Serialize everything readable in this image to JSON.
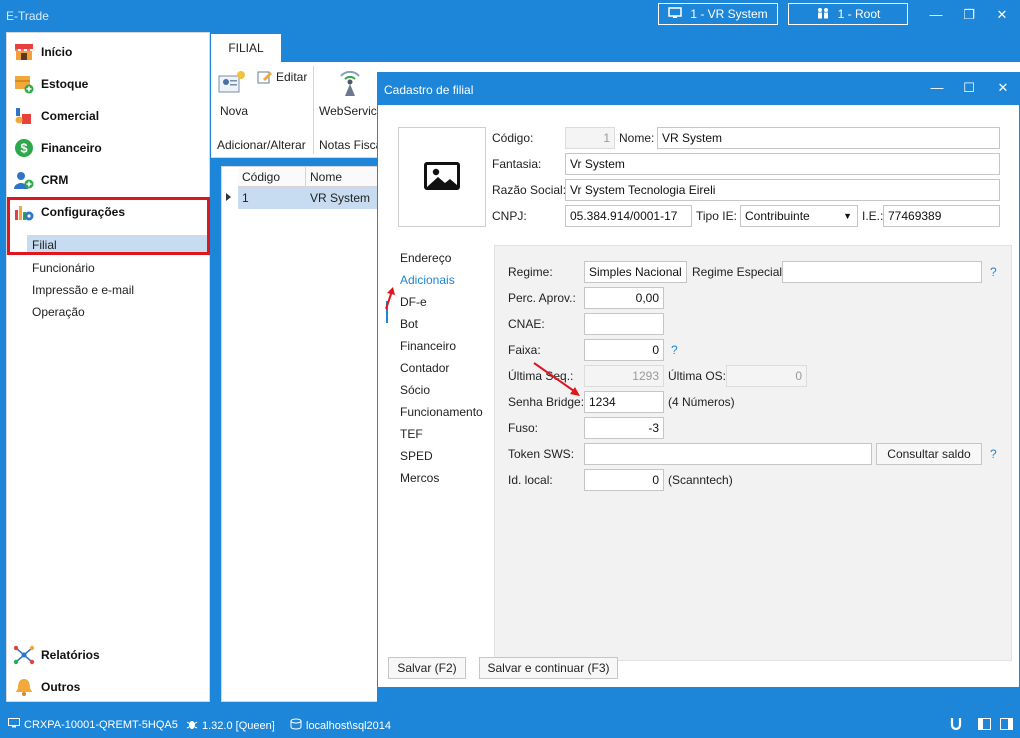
{
  "app": {
    "title": "E-Trade"
  },
  "top_bar": {
    "system_badge": "1 - VR System",
    "user_badge": "1 - Root"
  },
  "sidebar": {
    "items": [
      {
        "label": "Início"
      },
      {
        "label": "Estoque"
      },
      {
        "label": "Comercial"
      },
      {
        "label": "Financeiro"
      },
      {
        "label": "CRM"
      },
      {
        "label": "Configurações"
      }
    ],
    "sub_items": [
      {
        "label": "Filial"
      },
      {
        "label": "Funcionário"
      },
      {
        "label": "Impressão e e-mail"
      },
      {
        "label": "Operação"
      }
    ],
    "bottom_items": [
      {
        "label": "Relatórios"
      },
      {
        "label": "Outros"
      }
    ]
  },
  "background_page": {
    "tab": "FILIAL",
    "ribbon": {
      "nova": "Nova",
      "editar": "Editar",
      "webservice": "WebService",
      "group_add": "Adicionar/Alterar",
      "group_notas": "Notas Fisca"
    },
    "grid": {
      "headers": [
        "Código",
        "Nome"
      ],
      "rows": [
        {
          "codigo": "1",
          "nome": "VR System"
        }
      ]
    }
  },
  "dialog": {
    "title": "Cadastro de filial",
    "header": {
      "codigo_label": "Código:",
      "codigo_value": "1",
      "nome_label": "Nome:",
      "nome_value": "VR System",
      "fantasia_label": "Fantasia:",
      "fantasia_value": "Vr System",
      "razao_label": "Razão Social:",
      "razao_value": "Vr System Tecnologia Eireli",
      "cnpj_label": "CNPJ:",
      "cnpj_value": "05.384.914/0001-17",
      "tipo_ie_label": "Tipo IE:",
      "tipo_ie_value": "Contribuinte",
      "ie_label": "I.E.:",
      "ie_value": "77469389"
    },
    "tabs": [
      {
        "label": "Endereço"
      },
      {
        "label": "Adicionais"
      },
      {
        "label": "DF-e"
      },
      {
        "label": "Bot"
      },
      {
        "label": "Financeiro"
      },
      {
        "label": "Contador"
      },
      {
        "label": "Sócio"
      },
      {
        "label": "Funcionamento"
      },
      {
        "label": "TEF"
      },
      {
        "label": "SPED"
      },
      {
        "label": "Mercos"
      }
    ],
    "adicionais": {
      "regime_label": "Regime:",
      "regime_value": "Simples Nacional",
      "regime_especial_label": "Regime Especial:",
      "regime_especial_value": "",
      "perc_aprov_label": "Perc. Aprov.:",
      "perc_aprov_value": "0,00",
      "cnae_label": "CNAE:",
      "cnae_value": "",
      "faixa_label": "Faixa:",
      "faixa_value": "0",
      "ultima_seq_label": "Última Seq.:",
      "ultima_seq_value": "1293",
      "ultima_os_label": "Última OS:",
      "ultima_os_value": "0",
      "senha_bridge_label": "Senha Bridge:",
      "senha_bridge_value": "1234",
      "senha_bridge_hint": "(4 Números)",
      "fuso_label": "Fuso:",
      "fuso_value": "-3",
      "token_sws_label": "Token SWS:",
      "token_sws_value": "",
      "consultar_saldo": "Consultar saldo",
      "id_local_label": "Id. local:",
      "id_local_value": "0",
      "id_local_hint": "(Scanntech)",
      "help": "?"
    },
    "buttons": {
      "salvar": "Salvar (F2)",
      "salvar_continuar": "Salvar e continuar (F3)"
    }
  },
  "status_bar": {
    "machine": "CRXPA-10001-QREMT-5HQA5",
    "version": "1.32.0 [Queen]",
    "server": "localhost\\sql2014"
  },
  "colors": {
    "accent": "#1e86d8",
    "selection": "#c7dcf1",
    "highlight_red": "#e0161f"
  }
}
